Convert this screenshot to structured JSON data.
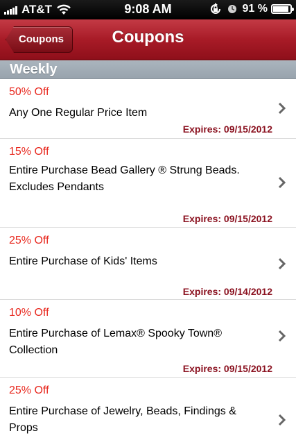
{
  "status_bar": {
    "carrier": "AT&T",
    "time": "9:08 AM",
    "battery_text": "91 %",
    "battery_level": 0.91
  },
  "nav": {
    "back_label": "Coupons",
    "title": "Coupons",
    "accent_color": "#a81b27"
  },
  "section": {
    "title": "Weekly"
  },
  "coupons": [
    {
      "discount": "50% Off",
      "description": "Any One Regular Price Item",
      "expires": "Expires: 09/15/2012"
    },
    {
      "discount": "15% Off",
      "description": "Entire Purchase Bead Gallery ® Strung Beads.  Excludes Pendants",
      "expires": "Expires: 09/15/2012"
    },
    {
      "discount": "25% Off",
      "description": "Entire Purchase of Kids' Items",
      "expires": "Expires: 09/14/2012"
    },
    {
      "discount": "10% Off",
      "description": "Entire Purchase of Lemax® Spooky Town® Collection",
      "expires": "Expires: 09/15/2012"
    },
    {
      "discount": "25% Off",
      "description": "Entire Purchase of Jewelry, Beads, Findings & Props",
      "expires": ""
    }
  ],
  "icons": {
    "row_disclosure": "chevron-right-icon",
    "wifi": "wifi-icon",
    "signal": "signal-bars-icon",
    "rotation_lock": "rotation-lock-icon",
    "alarm": "clock-icon",
    "battery": "battery-icon"
  }
}
